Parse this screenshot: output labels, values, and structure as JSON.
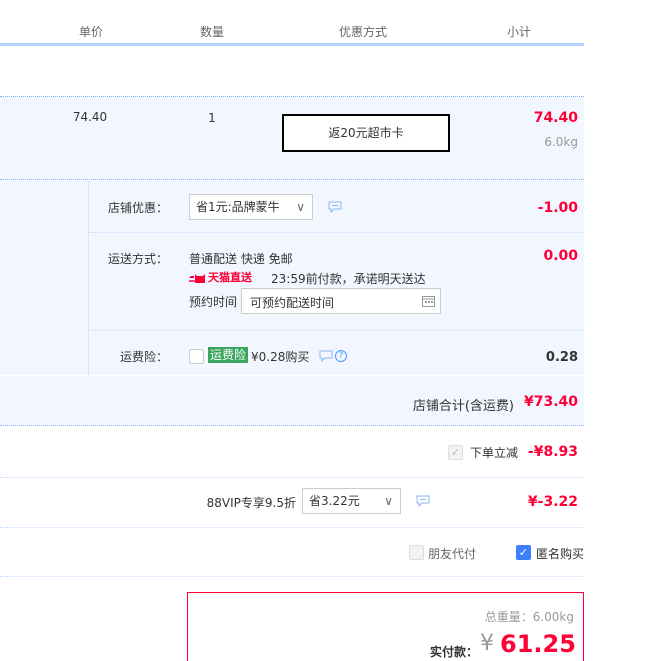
{
  "header": {
    "col_unit_price": "单价",
    "col_quantity": "数量",
    "col_discount": "优惠方式",
    "col_subtotal": "小计"
  },
  "item": {
    "unit_price": "74.40",
    "quantity": "1",
    "promo": "返20元超市卡",
    "subtotal": "74.40",
    "weight": "6.0kg"
  },
  "store_discount": {
    "label": "店铺优惠：",
    "selected": "省1元:品牌蒙牛",
    "amount": "-1.00"
  },
  "shipping": {
    "label": "运送方式：",
    "method": "普通配送 快递 免邮",
    "badge": "天猫直送",
    "promise": "23:59前付款，承诺明天送达",
    "reserve_label": "预约时间",
    "reserve_placeholder": "可预约配送时间",
    "amount": "0.00"
  },
  "insurance": {
    "label": "运费险：",
    "badge": "运费险",
    "price_text": "¥0.28购买",
    "amount": "0.28"
  },
  "store_total": {
    "label": "店铺合计(含运费)",
    "amount": "¥73.40"
  },
  "instant_discount": {
    "label": "下单立减",
    "amount": "-¥8.93"
  },
  "vip": {
    "label": "88VIP专享9.5折",
    "selected": "省3.22元",
    "amount": "¥-3.22"
  },
  "options": {
    "friend_pay": "朋友代付",
    "anonymous": "匿名购买"
  },
  "summary": {
    "weight_label": "总重量：",
    "weight": "6.00kg",
    "pay_label": "实付款：",
    "currency": "¥",
    "pay_amount": "61.25"
  },
  "colors": {
    "price_red": "#ff0036",
    "accent_blue": "#b2d1ff",
    "row_bg": "#f2f7ff",
    "insurance_green": "#3ba55d"
  }
}
